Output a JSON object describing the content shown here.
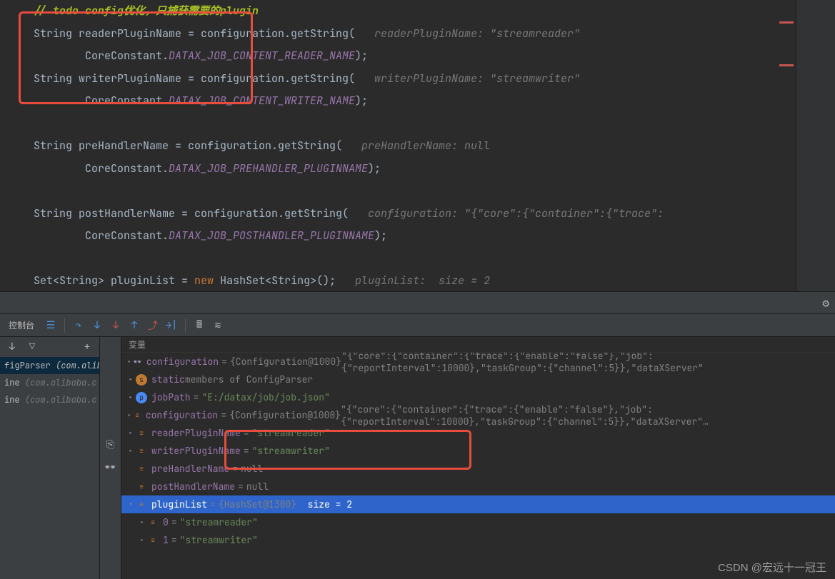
{
  "code": {
    "comment": "// todo config优化，只捕获需要的plugin",
    "l1a": "String readerPluginName = configuration.getString(",
    "l1hint": "readerPluginName: \"streamreader\"",
    "l2a": "CoreConstant.",
    "l2b": "DATAX_JOB_CONTENT_READER_NAME",
    "l2c": ");",
    "l3a": "String writerPluginName = configuration.getString(",
    "l3hint": "writerPluginName: \"streamwriter\"",
    "l4b": "DATAX_JOB_CONTENT_WRITER_NAME",
    "l5a": "String preHandlerName = configuration.getString(",
    "l5hint": "preHandlerName: null",
    "l6b": "DATAX_JOB_PREHANDLER_PLUGINNAME",
    "l7a": "String postHandlerName = configuration.getString(",
    "l7hint": "configuration: \"{\"core\":{\"container\":{\"trace\":",
    "l8b": "DATAX_JOB_POSTHANDLER_PLUGINNAME",
    "l9a": "Set",
    "l9b": "<String> pluginList = ",
    "l9c": "new",
    "l9d": " HashSet<String>();",
    "l9hint": "pluginList:  size = 2"
  },
  "debug": {
    "console_tab": "控制台",
    "vars_header": "变量",
    "frames": [
      {
        "label": "figParser",
        "pkg": "(com.alib"
      },
      {
        "label": "ine",
        "pkg": "(com.alibaba.c"
      },
      {
        "label": "ine",
        "pkg": "(com.alibaba.c"
      }
    ],
    "vars": {
      "configuration": {
        "name": "configuration",
        "type": "{Configuration@1000}",
        "val": "\"{\"core\":{\"container\":{\"trace\":{\"enable\":\"false\"},\"job\":{\"reportInterval\":10000},\"taskGroup\":{\"channel\":5}},\"dataXServer\""
      },
      "static": {
        "name": "static",
        "desc": "members of ConfigParser"
      },
      "jobPath": {
        "name": "jobPath",
        "val": "\"E:/datax/job/job.json\""
      },
      "configuration2": {
        "name": "configuration",
        "type": "{Configuration@1000}",
        "val": "\"{\"core\":{\"container\":{\"trace\":{\"enable\":\"false\"},\"job\":{\"reportInterval\":10000},\"taskGroup\":{\"channel\":5}},\"dataXServer\"…"
      },
      "readerPluginName": {
        "name": "readerPluginName",
        "val": "\"streamreader\""
      },
      "writerPluginName": {
        "name": "writerPluginName",
        "val": "\"streamwriter\""
      },
      "preHandlerName": {
        "name": "preHandlerName",
        "val": "null"
      },
      "postHandlerName": {
        "name": "postHandlerName",
        "val": "null"
      },
      "pluginList": {
        "name": "pluginList",
        "type": "{HashSet@1300}",
        "val": "size = 2"
      },
      "item0": {
        "name": "0",
        "val": "\"streamreader\""
      },
      "item1": {
        "name": "1",
        "val": "\"streamwriter\""
      }
    }
  },
  "watermark": "CSDN @宏远十一冠王"
}
